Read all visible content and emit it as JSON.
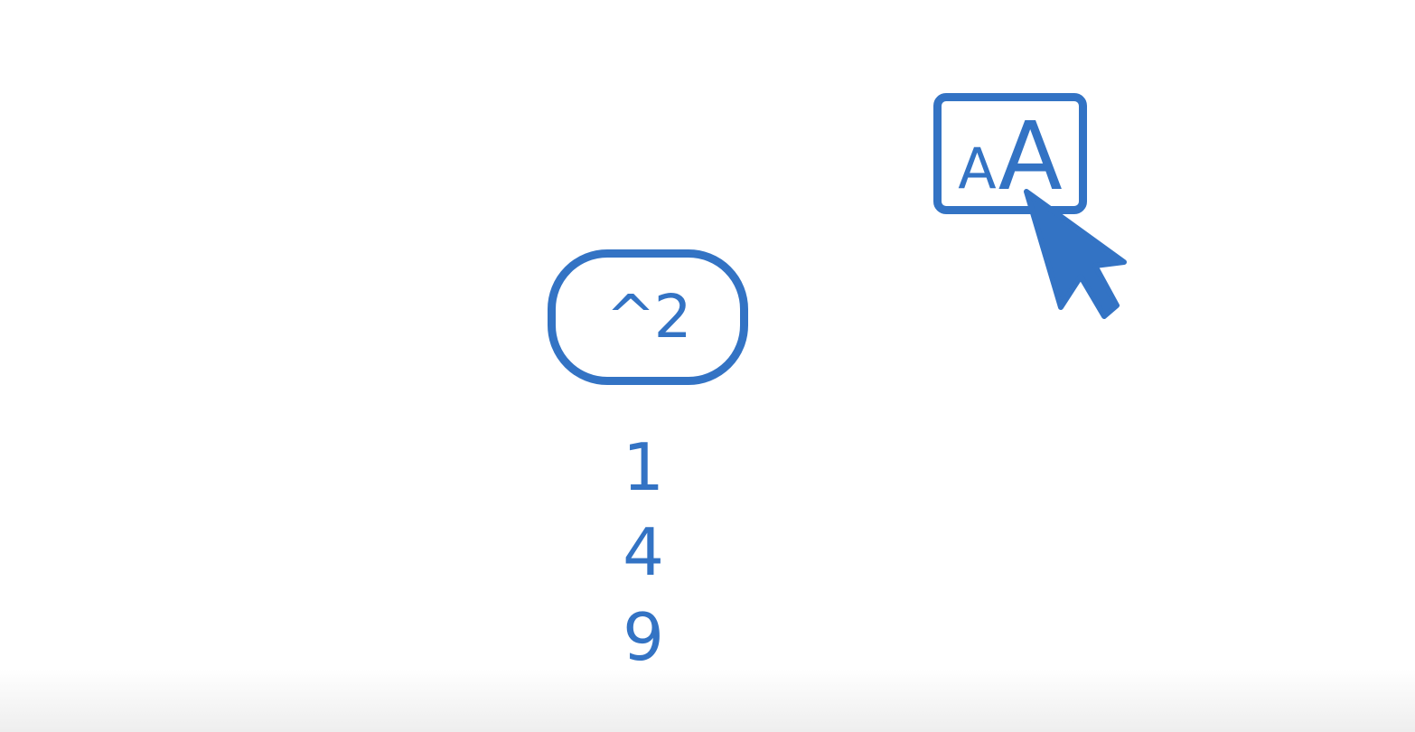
{
  "accent_color": "#3373c4",
  "squaring_button": {
    "label": "^2"
  },
  "output_values": [
    "1",
    "4",
    "9"
  ],
  "font_size_button": {
    "small_letter": "A",
    "large_letter": "A"
  },
  "icons": {
    "cursor": "mouse-pointer-icon"
  }
}
